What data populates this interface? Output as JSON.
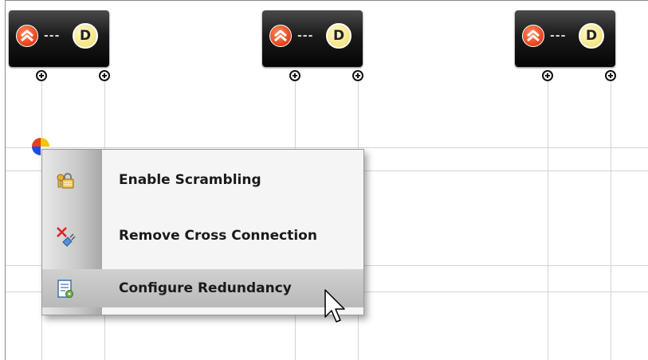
{
  "canvas": {
    "network_elements": [
      {
        "left_icon": "orange-chevrons-icon",
        "connector": "---",
        "right_label": "D"
      },
      {
        "left_icon": "orange-chevrons-icon",
        "connector": "---",
        "right_label": "D"
      },
      {
        "left_icon": "orange-chevrons-icon",
        "connector": "---",
        "right_label": "D"
      }
    ],
    "colors": {
      "node_bg": "#111111",
      "node_left_icon": "#e2421c",
      "node_right_badge": "#f4e27a",
      "grid_line": "#d4d4d4"
    }
  },
  "context_menu": {
    "items": [
      {
        "label": "Enable Scrambling",
        "icon": "key-lock-icon",
        "highlighted": false
      },
      {
        "label": "Remove Cross Connection",
        "icon": "unplug-icon",
        "highlighted": false
      },
      {
        "label": "Configure Redundancy",
        "icon": "config-document-icon",
        "highlighted": true
      }
    ]
  }
}
